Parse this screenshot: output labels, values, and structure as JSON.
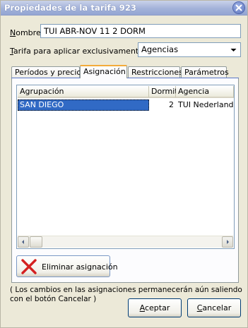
{
  "window": {
    "title": "Propiedades de la tarifa 923"
  },
  "form": {
    "nombre_label_u": "N",
    "nombre_label_rest": "ombre",
    "nombre_value": "TUI ABR-NOV 11 2 DORM",
    "tarifa_label_u": "T",
    "tarifa_label_rest": "arifa para aplicar exclusivamente a",
    "tarifa_value": "Agencias"
  },
  "tabs": [
    {
      "label": "Períodos y precios"
    },
    {
      "label": "Asignación"
    },
    {
      "label": "Restricciones"
    },
    {
      "label": "Parámetros"
    }
  ],
  "table": {
    "columns": [
      "Agrupación",
      "Dormit.",
      "Agencia"
    ],
    "rows": [
      {
        "agrupacion": "SAN DIEGO",
        "dormit": "2",
        "agencia": "TUI Nederland"
      }
    ]
  },
  "buttons": {
    "eliminar": "Eliminar asignación",
    "aceptar_u": "A",
    "aceptar_rest": "ceptar",
    "cancelar_u": "C",
    "cancelar_rest": "ancelar"
  },
  "note": "( Los cambios en las asignaciones permanecerán aún saliendo con el botón Cancelar )",
  "colors": {
    "selection": "#316ac5",
    "tab_accent": "#f3ab3a",
    "delete_icon": "#d42020"
  }
}
